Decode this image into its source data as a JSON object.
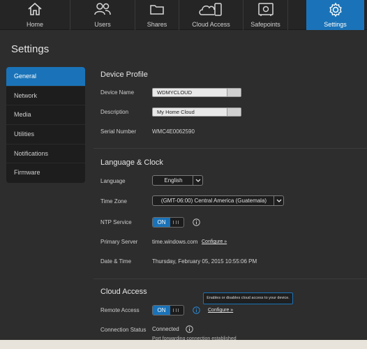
{
  "nav": {
    "items": [
      {
        "label": "Home",
        "icon": "home-icon"
      },
      {
        "label": "Users",
        "icon": "users-icon"
      },
      {
        "label": "Shares",
        "icon": "folder-icon"
      },
      {
        "label": "Cloud Access",
        "icon": "cloud-device-icon"
      },
      {
        "label": "Safepoints",
        "icon": "safe-icon"
      },
      {
        "label": "Settings",
        "icon": "gear-icon"
      }
    ],
    "active": "Settings",
    "active_color": "#1a73b8"
  },
  "page_title": "Settings",
  "sidebar": {
    "items": [
      {
        "label": "General"
      },
      {
        "label": "Network"
      },
      {
        "label": "Media"
      },
      {
        "label": "Utilities"
      },
      {
        "label": "Notifications"
      },
      {
        "label": "Firmware"
      }
    ],
    "active": "General"
  },
  "device_profile": {
    "title": "Device Profile",
    "device_name_label": "Device Name",
    "device_name_value": "WDMYCLOUD",
    "description_label": "Description",
    "description_value": "My Home Cloud",
    "serial_label": "Serial Number",
    "serial_value": "WMC4E0062590"
  },
  "language_clock": {
    "title": "Language & Clock",
    "language_label": "Language",
    "language_value": "English",
    "timezone_label": "Time Zone",
    "timezone_value": "(GMT-06:00) Central America (Guatemala)",
    "ntp_label": "NTP Service",
    "ntp_state": "ON",
    "primary_server_label": "Primary Server",
    "primary_server_value": "time.windows.com",
    "configure_label": "Configure »",
    "datetime_label": "Date & Time",
    "datetime_value": "Thursday, February 05, 2015 10:55:06 PM"
  },
  "cloud_access": {
    "title": "Cloud Access",
    "remote_access_label": "Remote Access",
    "remote_access_state": "ON",
    "configure_label": "Configure »",
    "tooltip": "Enables or disables cloud access to your device.",
    "connection_status_label": "Connection Status",
    "connection_status_value": "Connected",
    "connection_detail": "Port forwarding connection established"
  }
}
